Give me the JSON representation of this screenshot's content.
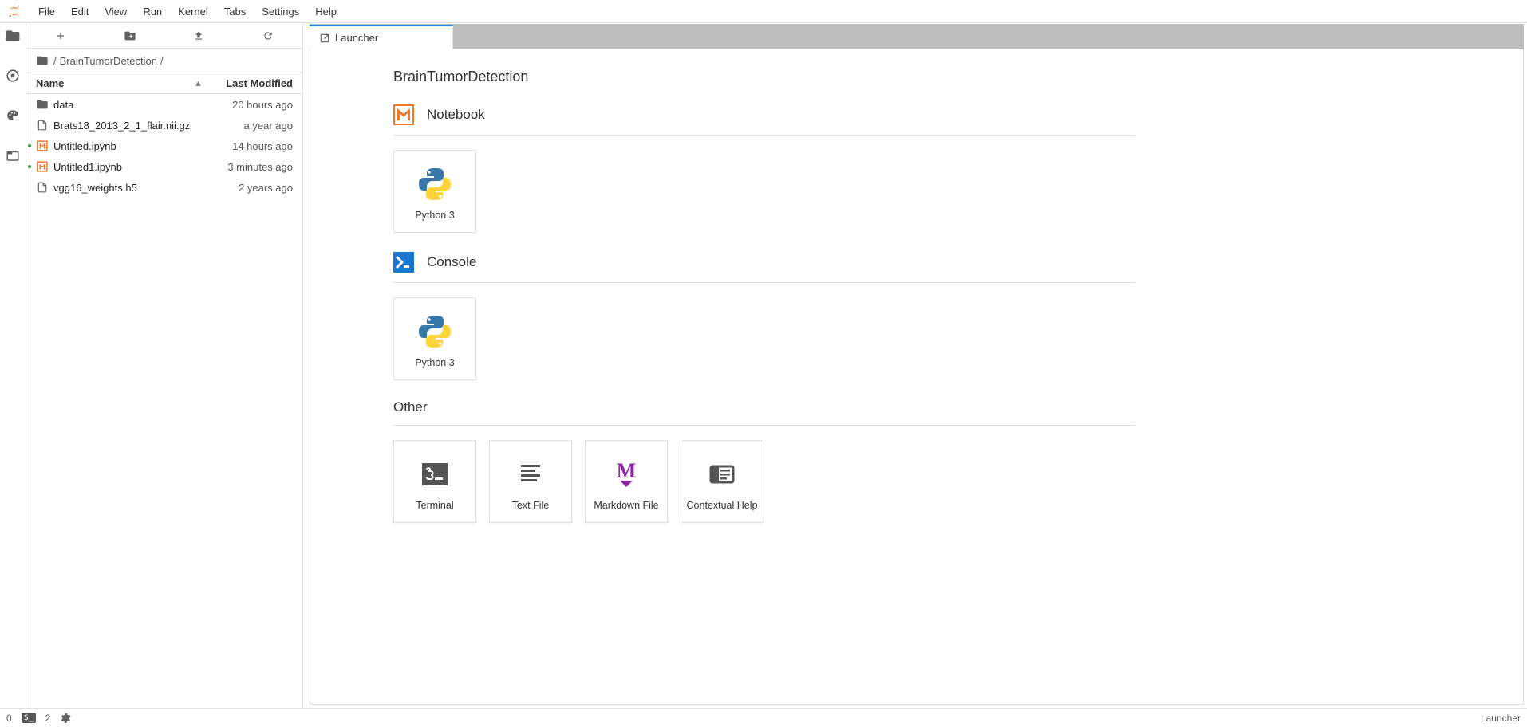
{
  "menu": {
    "items": [
      "File",
      "Edit",
      "View",
      "Run",
      "Kernel",
      "Tabs",
      "Settings",
      "Help"
    ]
  },
  "breadcrumb": {
    "root": "/",
    "segment": "BrainTumorDetection",
    "trail": "/"
  },
  "file_table": {
    "header_name": "Name",
    "header_modified": "Last Modified",
    "rows": [
      {
        "type": "folder",
        "name": "data",
        "modified": "20 hours ago",
        "running": false
      },
      {
        "type": "file",
        "name": "Brats18_2013_2_1_flair.nii.gz",
        "modified": "a year ago",
        "running": false
      },
      {
        "type": "notebook",
        "name": "Untitled.ipynb",
        "modified": "14 hours ago",
        "running": true
      },
      {
        "type": "notebook",
        "name": "Untitled1.ipynb",
        "modified": "3 minutes ago",
        "running": true
      },
      {
        "type": "file",
        "name": "vgg16_weights.h5",
        "modified": "2 years ago",
        "running": false
      }
    ]
  },
  "tab": {
    "title": "Launcher"
  },
  "launcher": {
    "cwd_title": "BrainTumorDetection",
    "sections": {
      "notebook": {
        "title": "Notebook",
        "cards": [
          {
            "label": "Python 3",
            "icon": "python"
          }
        ]
      },
      "console": {
        "title": "Console",
        "cards": [
          {
            "label": "Python 3",
            "icon": "python"
          }
        ]
      },
      "other": {
        "title": "Other",
        "cards": [
          {
            "label": "Terminal",
            "icon": "terminal"
          },
          {
            "label": "Text File",
            "icon": "textfile"
          },
          {
            "label": "Markdown File",
            "icon": "markdown"
          },
          {
            "label": "Contextual Help",
            "icon": "contexthelp"
          }
        ]
      }
    }
  },
  "status": {
    "pkg_count": "0",
    "term_count": "2",
    "right_label": "Launcher"
  },
  "colors": {
    "accent": "#1e88e5",
    "nb_orange": "#f37626",
    "console_blue": "#1976d2",
    "md_purple": "#8e24aa"
  }
}
